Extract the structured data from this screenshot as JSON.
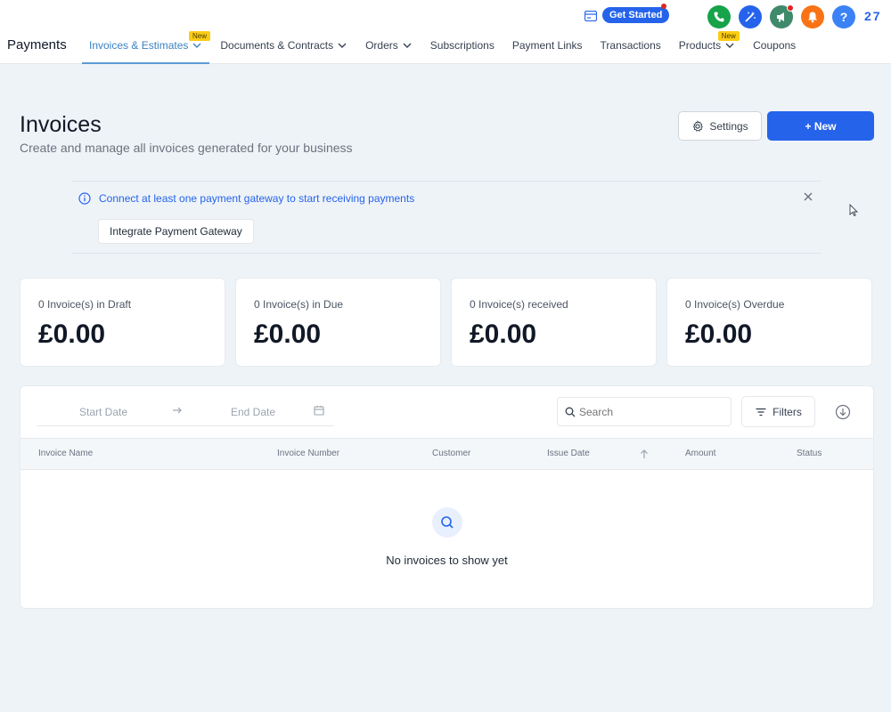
{
  "header": {
    "app_title": "Payments",
    "nav": [
      {
        "label": "Invoices & Estimates",
        "dropdown": true,
        "tag": "New",
        "active": true
      },
      {
        "label": "Documents & Contracts",
        "dropdown": true
      },
      {
        "label": "Orders",
        "dropdown": true
      },
      {
        "label": "Subscriptions",
        "dropdown": false
      },
      {
        "label": "Payment Links",
        "dropdown": false
      },
      {
        "label": "Transactions",
        "dropdown": false
      },
      {
        "label": "Products",
        "dropdown": true,
        "tag": "New"
      },
      {
        "label": "Coupons",
        "dropdown": false
      }
    ],
    "get_started_label": "Get Started",
    "user_number": "27",
    "action_icons": [
      "phone-icon",
      "magic-icon",
      "megaphone-icon",
      "bell-icon",
      "help-icon"
    ]
  },
  "page": {
    "title": "Invoices",
    "subtitle": "Create and manage all invoices generated for your business",
    "settings_label": "Settings",
    "new_label": "+ New"
  },
  "banner": {
    "message": "Connect at least one payment gateway to start receiving payments",
    "button_label": "Integrate Payment Gateway"
  },
  "stats": [
    {
      "label": "0 Invoice(s) in Draft",
      "value": "£0.00"
    },
    {
      "label": "0 Invoice(s) in Due",
      "value": "£0.00"
    },
    {
      "label": "0 Invoice(s) received",
      "value": "£0.00"
    },
    {
      "label": "0 Invoice(s) Overdue",
      "value": "£0.00"
    }
  ],
  "table": {
    "start_date_placeholder": "Start Date",
    "end_date_placeholder": "End Date",
    "search_placeholder": "Search",
    "filters_label": "Filters",
    "columns": [
      "Invoice Name",
      "Invoice Number",
      "Customer",
      "Issue Date",
      "Amount",
      "Status"
    ],
    "empty_message": "No invoices to show yet"
  },
  "colors": {
    "primary": "#2563eb",
    "phone": "#16a34a",
    "magic": "#2563eb",
    "megaphone": "#3f8a6b",
    "bell": "#f97316",
    "help": "#3b82f6"
  }
}
